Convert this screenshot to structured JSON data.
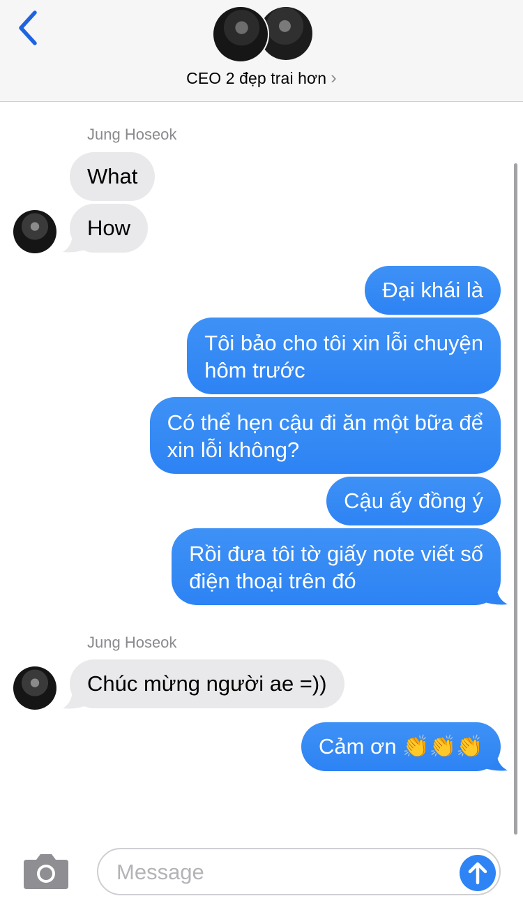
{
  "header": {
    "title": "CEO 2 đẹp trai hơn",
    "back_icon": "chevron-left-icon",
    "title_chevron": "›"
  },
  "messages": {
    "sender1": "Jung Hoseok",
    "m1": "What",
    "m2": "How",
    "m3": "Đại khái là",
    "m4": "Tôi bảo cho tôi xin lỗi chuyện\nhôm trước",
    "m5": "Có thể hẹn cậu đi ăn một bữa để\nxin lỗi không?",
    "m6": "Cậu ấy đồng ý",
    "m7": "Rồi đưa tôi tờ giấy note viết số\nđiện thoại trên đó",
    "sender2": "Jung Hoseok",
    "m8": "Chúc mừng người ae =))",
    "m9": "Cảm ơn 👏👏👏"
  },
  "composer": {
    "placeholder": "Message",
    "value": "",
    "camera_icon": "camera-icon",
    "send_icon": "arrow-up-icon"
  },
  "colors": {
    "outgoing": "#2d83f4",
    "incoming": "#e9e9eb",
    "accent": "#1e63e0"
  }
}
